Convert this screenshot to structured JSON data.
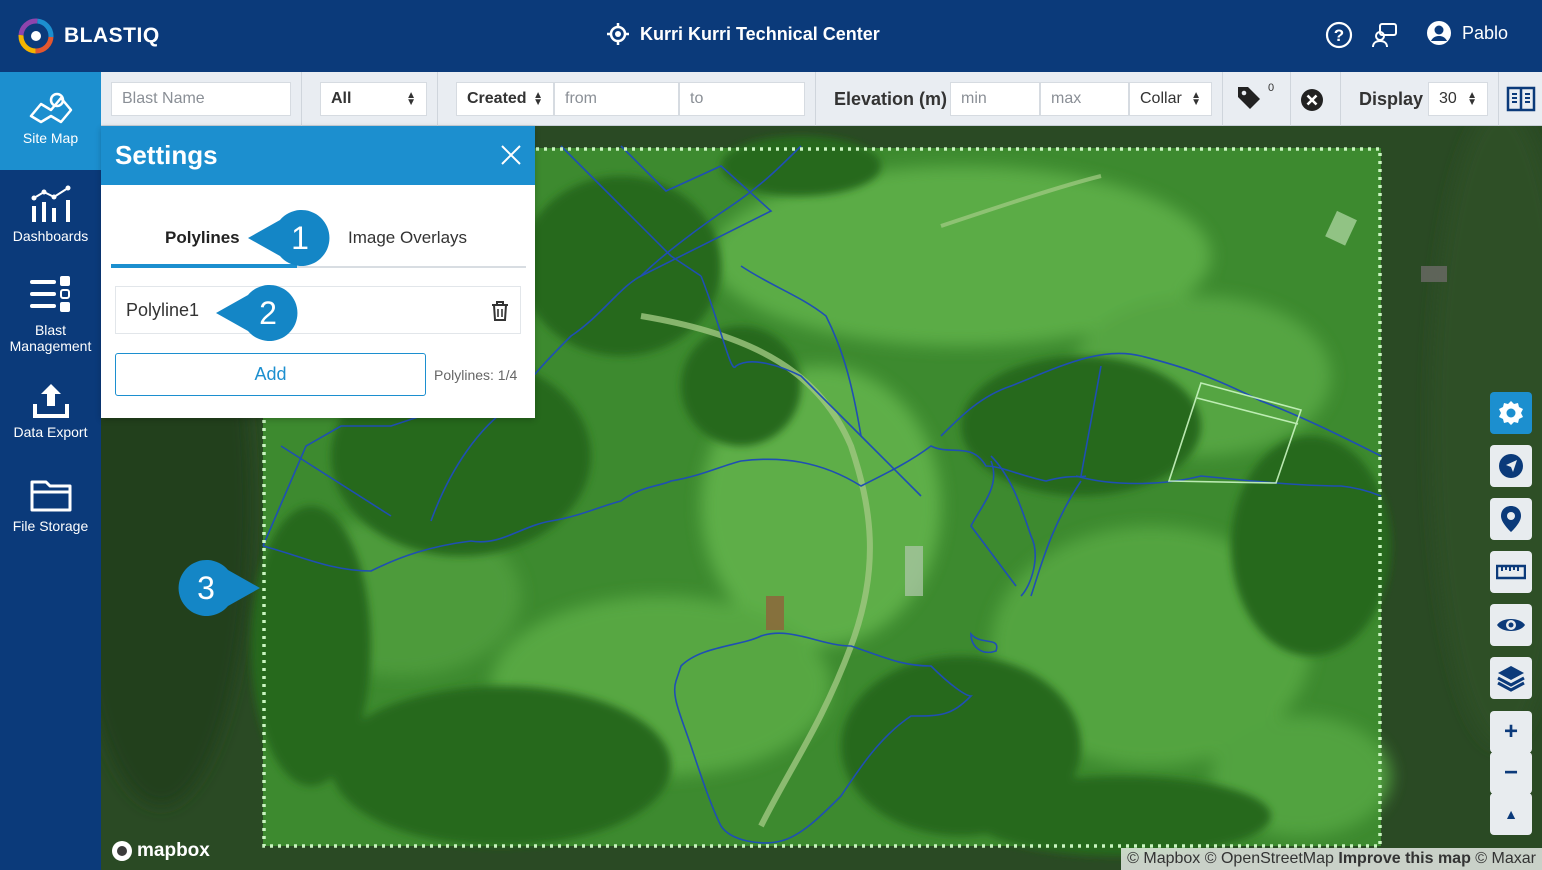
{
  "app": {
    "logo": "BLASTIQ",
    "site": "Kurri Kurri Technical Center",
    "user": "Pablo"
  },
  "sidebar": {
    "items": [
      {
        "label": "Site Map",
        "icon": "map-icon",
        "active": true
      },
      {
        "label": "Dashboards",
        "icon": "dashboard-icon"
      },
      {
        "label": "Blast Management",
        "icon": "blast-management-icon"
      },
      {
        "label": "Data Export",
        "icon": "upload-icon"
      },
      {
        "label": "File Storage",
        "icon": "folder-icon"
      }
    ]
  },
  "filters": {
    "blast_name_placeholder": "Blast Name",
    "status_value": "All",
    "date_field": "Created",
    "from_placeholder": "from",
    "to_placeholder": "to",
    "elevation_label": "Elevation (m)",
    "min_placeholder": "min",
    "max_placeholder": "max",
    "elevation_ref": "Collar",
    "tag_count": "0",
    "display_label": "Display",
    "display_value": "30"
  },
  "settings": {
    "title": "Settings",
    "tabs": [
      {
        "label": "Polylines",
        "active": true
      },
      {
        "label": "Image Overlays",
        "active": false
      }
    ],
    "polylines": [
      {
        "name": "Polyline1"
      }
    ],
    "add_label": "Add",
    "count_text": "Polylines: 1/4"
  },
  "callouts": [
    "1",
    "2",
    "3"
  ],
  "map": {
    "attribution": {
      "a": "© Mapbox © OpenStreetMap ",
      "improve": "Improve this map",
      "b": " © Maxar"
    },
    "mapbox_logo": "mapbox",
    "controls": [
      "gear-icon",
      "navigate-icon",
      "pin-icon",
      "ruler-icon",
      "eye-icon",
      "layers-icon",
      "plus-icon",
      "minus-icon",
      "north-icon"
    ]
  },
  "colors": {
    "header": "#0b3a7a",
    "accent": "#1c8fcf",
    "callout": "#1486c6",
    "polyline": "#1f4fb3",
    "boundary": "#c9f5c0"
  }
}
